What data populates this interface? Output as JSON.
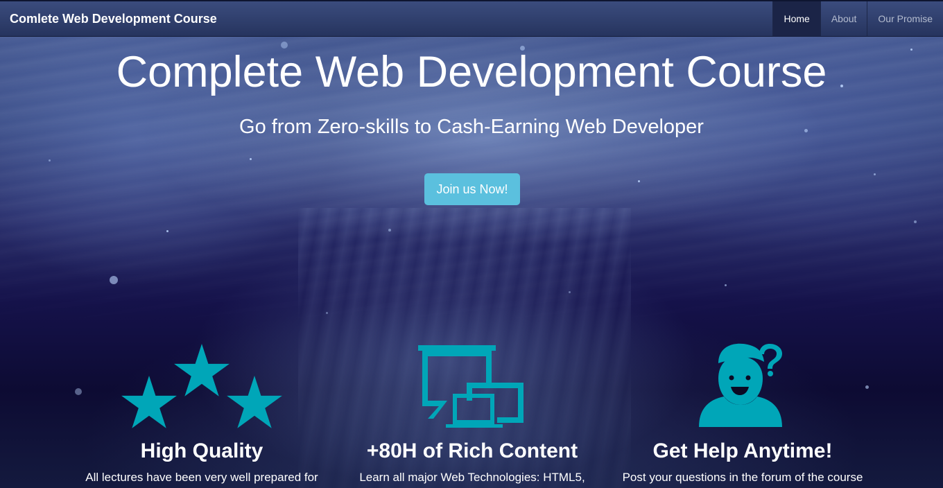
{
  "navbar": {
    "brand": "Comlete Web Development Course",
    "items": [
      {
        "label": "Home",
        "active": true
      },
      {
        "label": "About",
        "active": false
      },
      {
        "label": "Our Promise",
        "active": false
      }
    ]
  },
  "hero": {
    "title": "Complete Web Development Course",
    "subtitle": "Go from Zero-skills to Cash-Earning Web Developer",
    "cta_label": "Join us Now!"
  },
  "features": [
    {
      "icon": "stars-icon",
      "title": "High Quality",
      "text": "All lectures have been very well prepared for"
    },
    {
      "icon": "devices-icon",
      "title": "+80H of Rich Content",
      "text": "Learn all major Web Technologies: HTML5,"
    },
    {
      "icon": "user-question-icon",
      "title": "Get Help Anytime!",
      "text": "Post your questions in the forum of the course"
    }
  ],
  "colors": {
    "accent": "#00a6b8",
    "cta": "#5bc0de",
    "navbar": "#2e3d6c",
    "text": "#ffffff"
  }
}
